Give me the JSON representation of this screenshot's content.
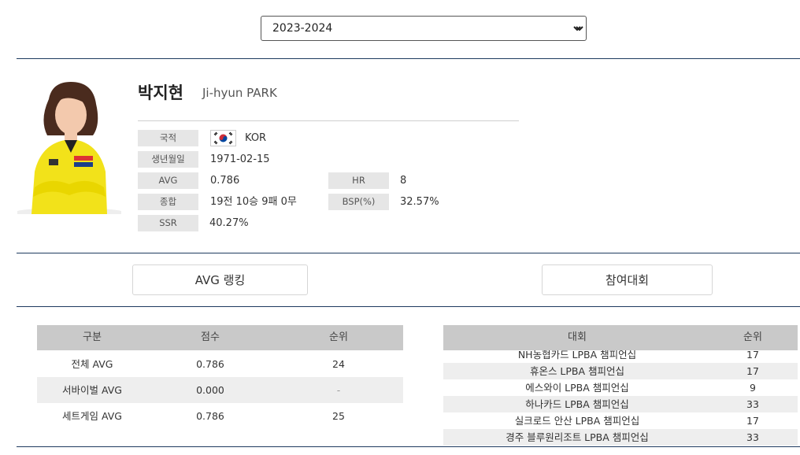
{
  "season_select": {
    "selected": "2023-2024"
  },
  "player": {
    "name_ko": "박지현",
    "name_en": "Ji-hyun PARK",
    "photo_alt": "player-photo",
    "fields": {
      "nationality_label": "국적",
      "nationality_value": "KOR",
      "birth_label": "생년월일",
      "birth_value": "1971-02-15",
      "avg_label": "AVG",
      "avg_value": "0.786",
      "hr_label": "HR",
      "hr_value": "8",
      "record_label": "종합",
      "record_value": "19전 10승 9패 0무",
      "bsp_label": "BSP(%)",
      "bsp_value": "32.57%",
      "ssr_label": "SSR",
      "ssr_value": "40.27%"
    }
  },
  "buttons": {
    "avg_ranking": "AVG 랭킹",
    "tournaments": "참여대회"
  },
  "avg_table": {
    "headers": [
      "구분",
      "점수",
      "순위"
    ],
    "rows": [
      [
        "전체 AVG",
        "0.786",
        "24"
      ],
      [
        "서바이벌 AVG",
        "0.000",
        "-"
      ],
      [
        "세트게임 AVG",
        "0.786",
        "25"
      ]
    ]
  },
  "tournament_table": {
    "headers": [
      "대회",
      "순위"
    ],
    "rows": [
      [
        "NH농협카드 LPBA 챔피언십",
        "17"
      ],
      [
        "휴온스 LPBA 챔피언십",
        "17"
      ],
      [
        "에스와이 LPBA 챔피언십",
        "9"
      ],
      [
        "하나카드 LPBA 챔피언십",
        "33"
      ],
      [
        "실크로드 안산 LPBA 챔피언십",
        "17"
      ],
      [
        "경주 블루원리조트 LPBA 챔피언십",
        "33"
      ]
    ]
  },
  "colors": {
    "rule": "#1e3a5f",
    "label_bg": "#e6e6e6",
    "header_bg": "#c9c9c9",
    "player_jersey": "#f2e21a"
  }
}
